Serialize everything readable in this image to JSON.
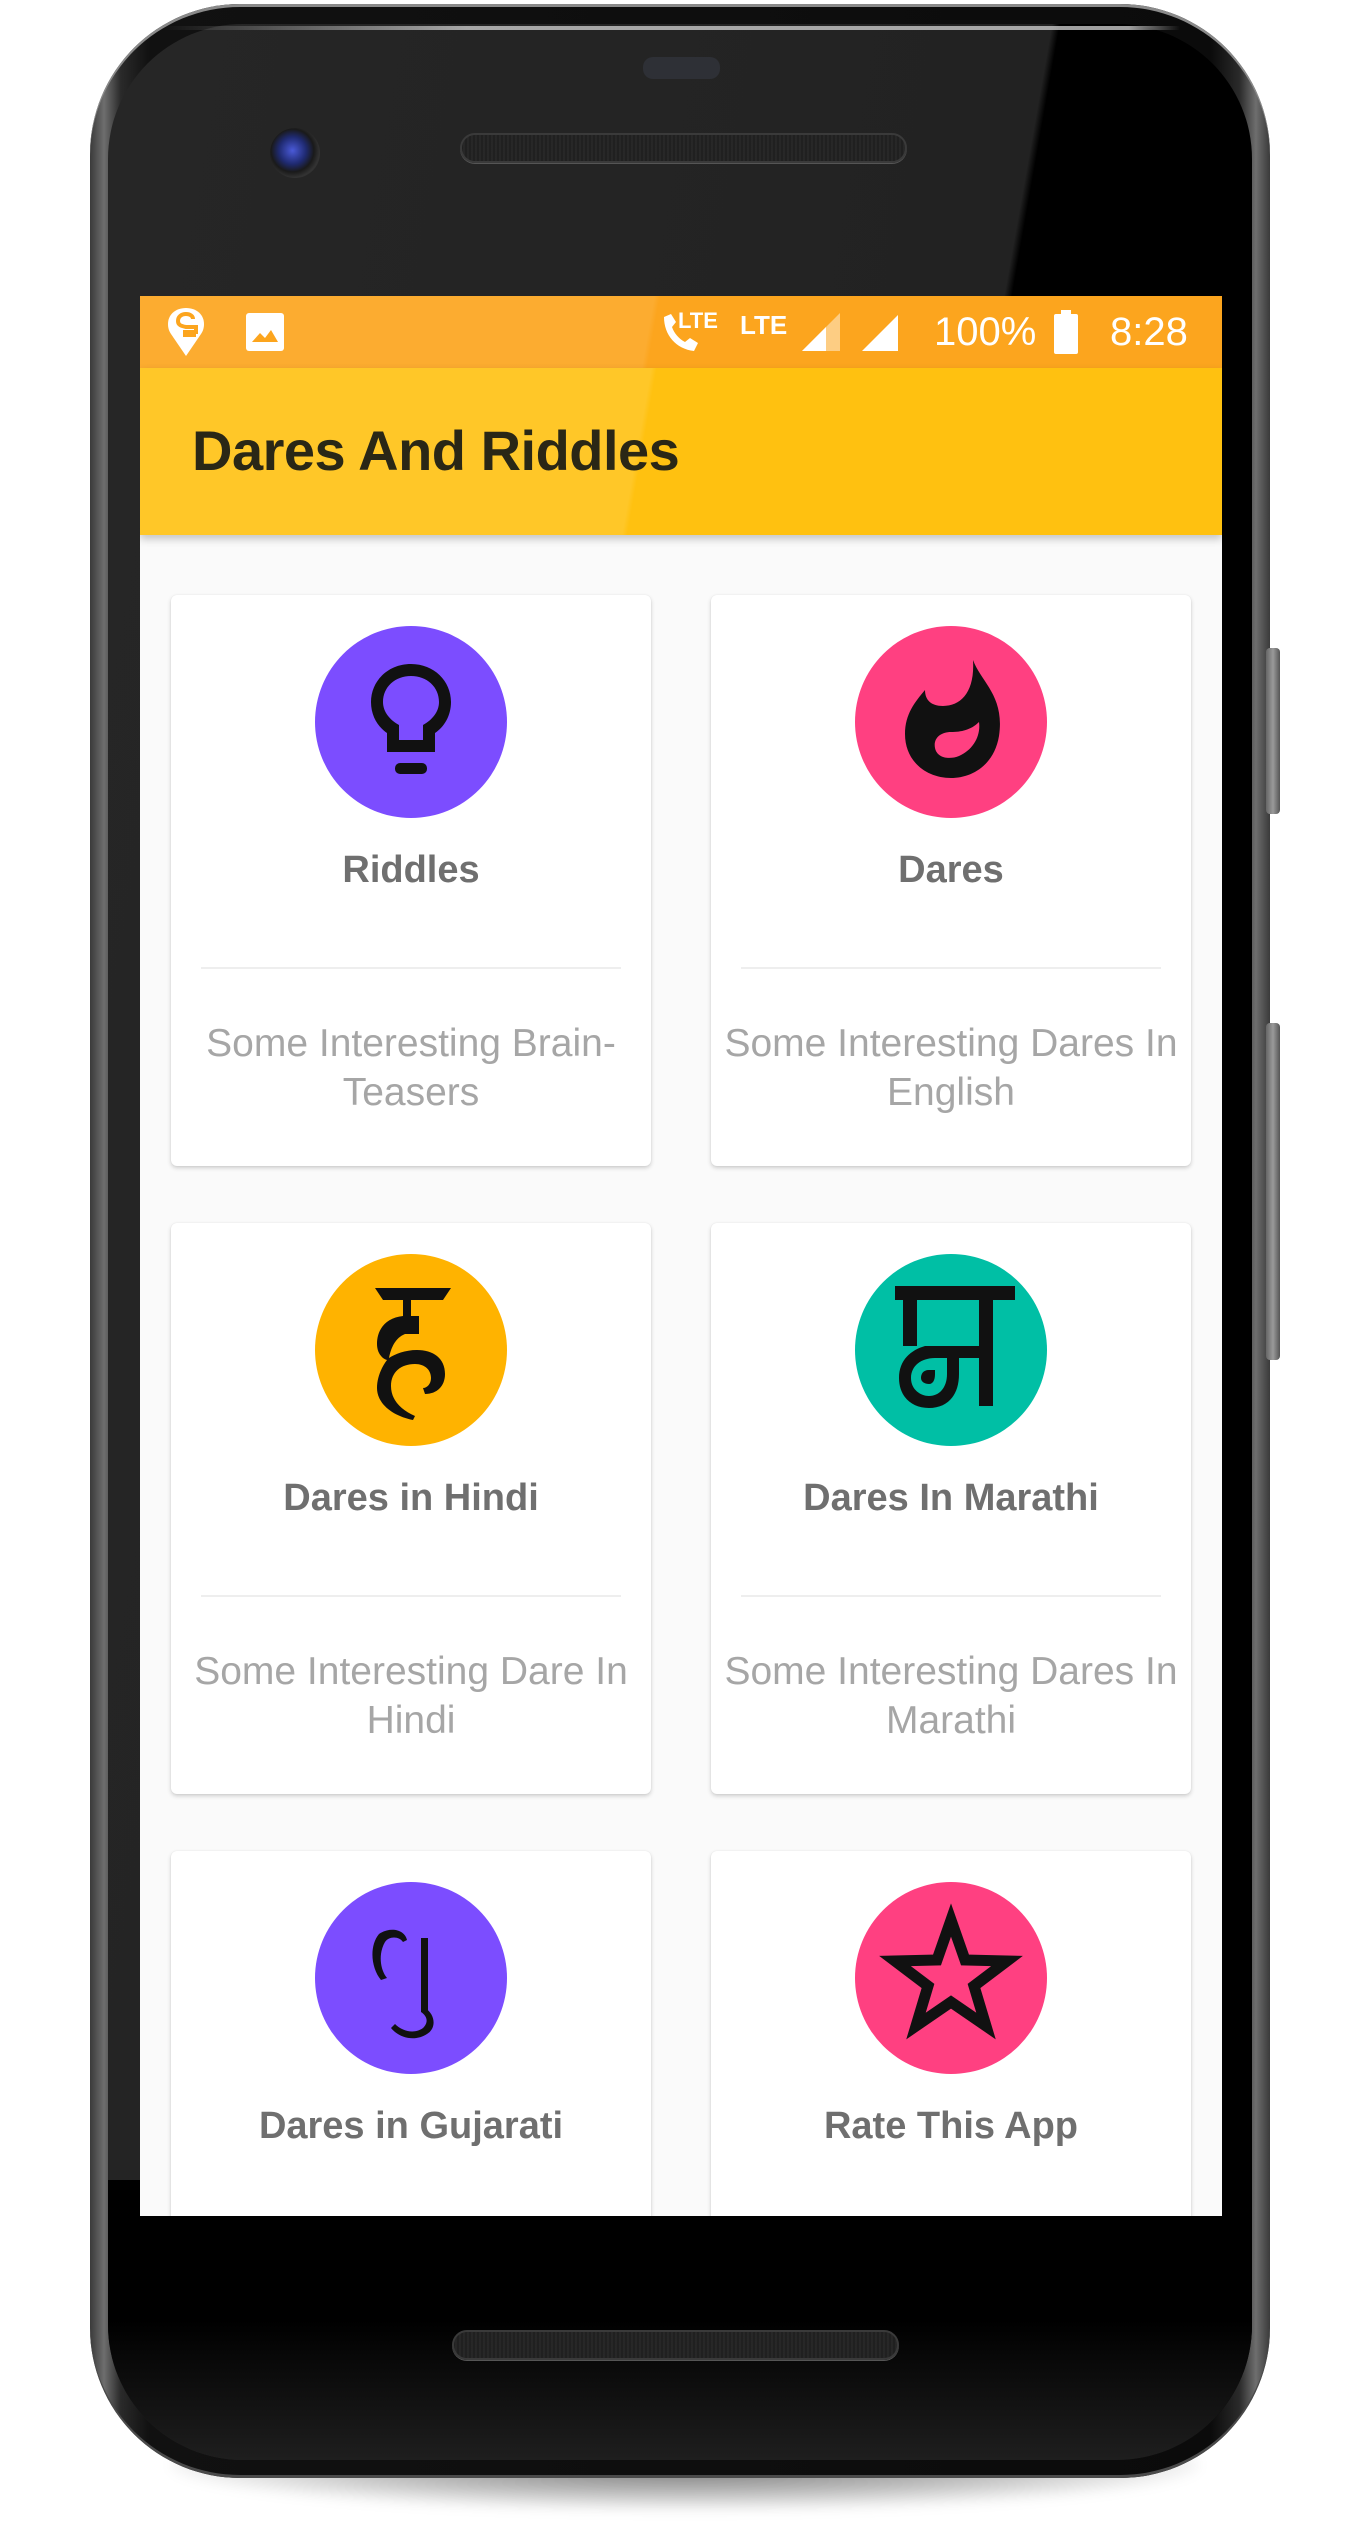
{
  "status_bar": {
    "left_icons": [
      "swiggy-notification-icon",
      "image-notification-icon"
    ],
    "volte_label": "LTE",
    "network_label": "LTE",
    "battery_percent": "100%",
    "battery_level": 1.0,
    "time": "8:28",
    "color": "#fca51e"
  },
  "app_bar": {
    "title": "Dares And Riddles",
    "color": "#ffc110"
  },
  "cards": [
    {
      "title": "Riddles",
      "description": "Some Interesting Brain-Teasers",
      "icon": "lightbulb-icon",
      "icon_color": "#7c4dff"
    },
    {
      "title": "Dares",
      "description": "Some Interesting Dares In English",
      "icon": "flame-icon",
      "icon_color": "#ff4081"
    },
    {
      "title": "Dares in Hindi",
      "description": "Some Interesting Dare In Hindi",
      "icon": "hindi-letter-ha-icon",
      "icon_glyph": "ह",
      "icon_color": "#ffb300"
    },
    {
      "title": "Dares In Marathi",
      "description": "Some Interesting Dares In Marathi",
      "icon": "marathi-letter-ma-icon",
      "icon_glyph": "म",
      "icon_color": "#00bfa5"
    },
    {
      "title": "Dares in Gujarati",
      "description": "",
      "icon": "gujarati-letter-gu-icon",
      "icon_glyph": "ગુ",
      "icon_color": "#7c4dff"
    },
    {
      "title": "Rate This App",
      "description": "",
      "icon": "star-icon",
      "icon_color": "#ff4081"
    }
  ]
}
